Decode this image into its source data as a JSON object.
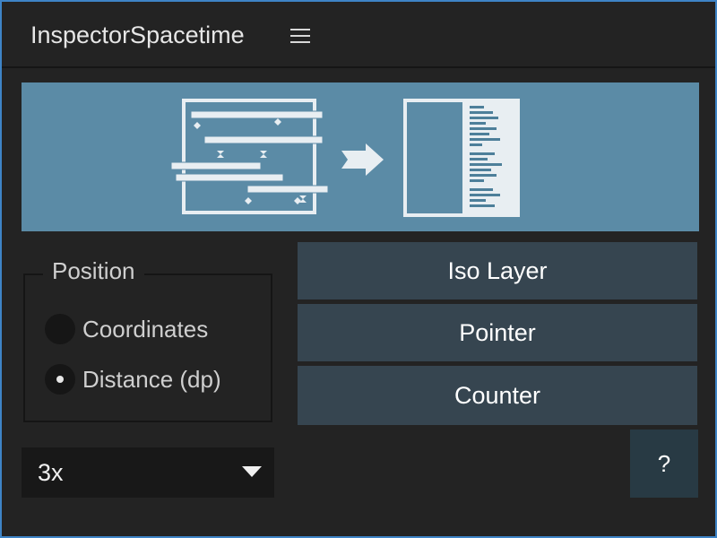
{
  "window": {
    "title": "InspectorSpacetime",
    "menu_icon": "hamburger-menu-icon"
  },
  "colors": {
    "accent_border": "#3e84c6",
    "banner_bg": "#5b8ba6",
    "button_bg": "#364550",
    "help_bg": "#283a44",
    "panel_bg": "#232323"
  },
  "banner": {
    "icon": "timeline-to-spec-illustration"
  },
  "position": {
    "legend": "Position",
    "options": [
      {
        "label": "Coordinates",
        "checked": false
      },
      {
        "label": "Distance (dp)",
        "checked": true
      }
    ]
  },
  "actions": {
    "buttons": [
      {
        "label": "Iso Layer"
      },
      {
        "label": "Pointer"
      },
      {
        "label": "Counter"
      }
    ]
  },
  "scale": {
    "selected": "3x",
    "icon": "triangle-down-icon"
  },
  "help": {
    "label": "?"
  }
}
